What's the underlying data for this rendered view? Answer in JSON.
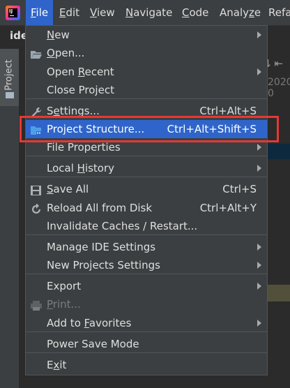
{
  "menubar": {
    "items": [
      {
        "label": "File",
        "mnemonic_index": 0
      },
      {
        "label": "Edit",
        "mnemonic_index": 0
      },
      {
        "label": "View",
        "mnemonic_index": 0
      },
      {
        "label": "Navigate",
        "mnemonic_index": 0
      },
      {
        "label": "Code",
        "mnemonic_index": 0
      },
      {
        "label": "Analyze",
        "mnemonic_index": 5
      },
      {
        "label": "Refa",
        "mnemonic_index": -1
      }
    ]
  },
  "background": {
    "crumb": "ide",
    "project_tab": "Project",
    "date_fragment": "2020-0",
    "toolbar_glyphs": "⇅ ⇤"
  },
  "file_menu": {
    "items": [
      {
        "label": "New",
        "mn": 0,
        "shortcut": "",
        "submenu": true,
        "icon": ""
      },
      {
        "label": "Open...",
        "mn": 0,
        "shortcut": "",
        "submenu": false,
        "icon": "folder-open-icon"
      },
      {
        "label": "Open Recent",
        "mn": 5,
        "shortcut": "",
        "submenu": true,
        "icon": ""
      },
      {
        "label": "Close Project",
        "mn": -1,
        "shortcut": "",
        "submenu": false,
        "icon": ""
      },
      {
        "label": "Settings...",
        "mn": 1,
        "shortcut": "Ctrl+Alt+S",
        "submenu": false,
        "icon": "wrench-icon"
      },
      {
        "label": "Project Structure...",
        "mn": -1,
        "shortcut": "Ctrl+Alt+Shift+S",
        "submenu": false,
        "icon": "project-structure-icon",
        "selected": true
      },
      {
        "label": "File Properties",
        "mn": -1,
        "shortcut": "",
        "submenu": true,
        "icon": ""
      },
      {
        "label": "Local History",
        "mn": 6,
        "shortcut": "",
        "submenu": true,
        "icon": ""
      },
      {
        "label": "Save All",
        "mn": 0,
        "shortcut": "Ctrl+S",
        "submenu": false,
        "icon": "save-icon"
      },
      {
        "label": "Reload All from Disk",
        "mn": -1,
        "shortcut": "Ctrl+Alt+Y",
        "submenu": false,
        "icon": "reload-icon"
      },
      {
        "label": "Invalidate Caches / Restart...",
        "mn": -1,
        "shortcut": "",
        "submenu": false,
        "icon": ""
      },
      {
        "label": "Manage IDE Settings",
        "mn": -1,
        "shortcut": "",
        "submenu": true,
        "icon": ""
      },
      {
        "label": "New Projects Settings",
        "mn": -1,
        "shortcut": "",
        "submenu": true,
        "icon": ""
      },
      {
        "label": "Export",
        "mn": -1,
        "shortcut": "",
        "submenu": true,
        "icon": ""
      },
      {
        "label": "Print...",
        "mn": 0,
        "shortcut": "",
        "submenu": false,
        "icon": "print-icon",
        "disabled": true
      },
      {
        "label": "Add to Favorites",
        "mn": 7,
        "shortcut": "",
        "submenu": true,
        "icon": ""
      },
      {
        "label": "Power Save Mode",
        "mn": -1,
        "shortcut": "",
        "submenu": false,
        "icon": ""
      },
      {
        "label": "Exit",
        "mn": 1,
        "shortcut": "",
        "submenu": false,
        "icon": ""
      }
    ]
  },
  "colors": {
    "menu_bg": "#3c3f41",
    "selection": "#2f65ca",
    "annotation_box": "#e53935"
  }
}
